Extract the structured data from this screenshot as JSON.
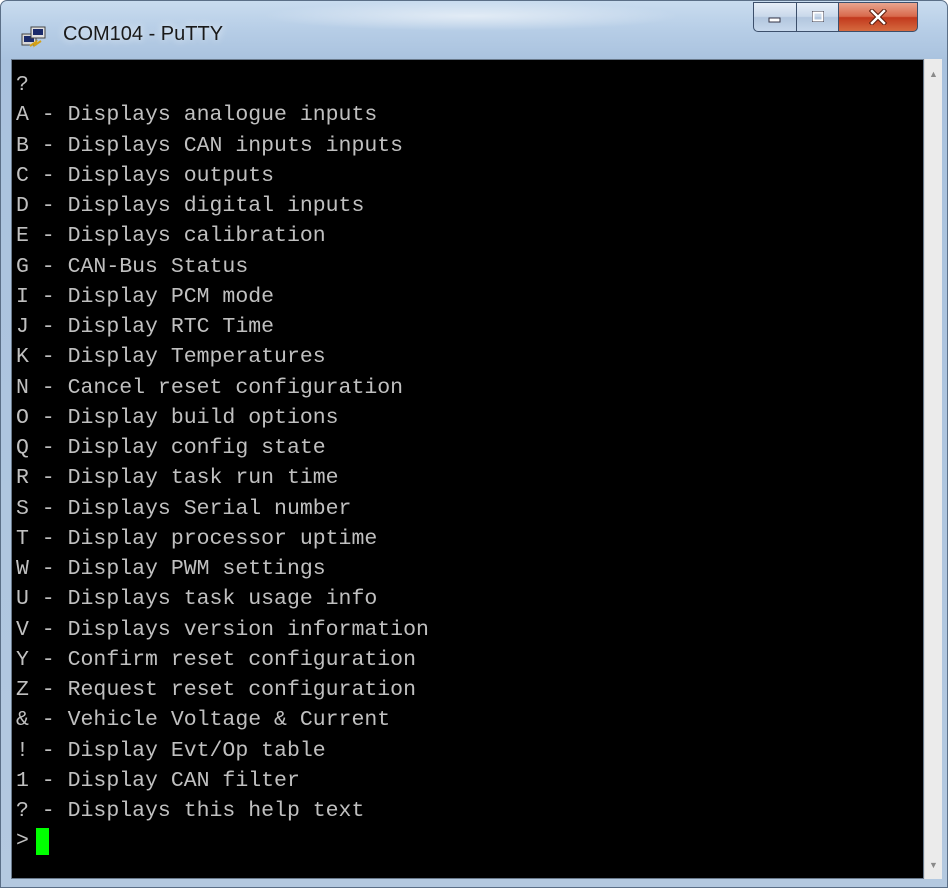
{
  "window": {
    "title": "COM104 - PuTTY",
    "icon": "putty-app-icon",
    "controls": [
      "minimize-icon",
      "maximize-icon",
      "close-icon"
    ]
  },
  "terminal": {
    "lines": [
      "?",
      "A - Displays analogue inputs",
      "B - Displays CAN inputs inputs",
      "C - Displays outputs",
      "D - Displays digital inputs",
      "E - Displays calibration",
      "G - CAN-Bus Status",
      "I - Display PCM mode",
      "J - Display RTC Time",
      "K - Display Temperatures",
      "N - Cancel reset configuration",
      "O - Display build options",
      "Q - Display config state",
      "R - Display task run time",
      "S - Displays Serial number",
      "T - Display processor uptime",
      "W - Display PWM settings",
      "U - Displays task usage info",
      "V - Displays version information",
      "Y - Confirm reset configuration",
      "Z - Request reset configuration",
      "& - Vehicle Voltage & Current",
      "! - Display Evt/Op table",
      "1 - Display CAN filter",
      "? - Displays this help text"
    ],
    "prompt": ">",
    "cursor_color": "#00ff00",
    "text_color": "#c0c0c0",
    "background": "#000000"
  },
  "scrollbar": {
    "up_arrow": "▲",
    "down_arrow": "▼"
  }
}
